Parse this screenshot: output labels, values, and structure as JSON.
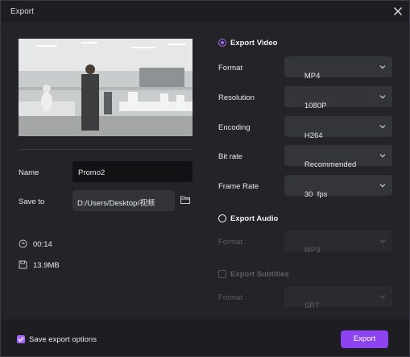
{
  "dialog": {
    "title": "Export",
    "close_icon": "close-icon"
  },
  "preview": {
    "icon": "video-thumbnail"
  },
  "name": {
    "label": "Name",
    "value": "Promo2"
  },
  "save_to": {
    "label": "Save to",
    "value": "D:/Users/Desktop/视频",
    "icon": "folder-icon"
  },
  "info": {
    "duration": "00:14",
    "duration_icon": "clock-icon",
    "size": "13.9MB",
    "size_icon": "disk-icon"
  },
  "export_video": {
    "title": "Export Video",
    "selected": true,
    "format": {
      "label": "Format",
      "value": "MP4"
    },
    "resolution": {
      "label": "Resolution",
      "value": "1080P"
    },
    "encoding": {
      "label": "Encoding",
      "value": "H264"
    },
    "bitrate": {
      "label": "Bit rate",
      "value": "Recommended"
    },
    "framerate": {
      "label": "Frame Rate",
      "value": "30  fps"
    }
  },
  "export_audio": {
    "title": "Export Audio",
    "selected": false,
    "format": {
      "label": "Format",
      "value": "MP3"
    }
  },
  "export_subtitles": {
    "title": "Export Subtitles",
    "checked": false,
    "format": {
      "label": "Format",
      "value": "SRT"
    }
  },
  "footer": {
    "save_options_label": "Save export options",
    "save_options_checked": true,
    "export_label": "Export"
  },
  "colors": {
    "accent": "#8b44f0",
    "accent_light": "#a66cf5",
    "panel": "#232329",
    "footer": "#1d1d22"
  }
}
